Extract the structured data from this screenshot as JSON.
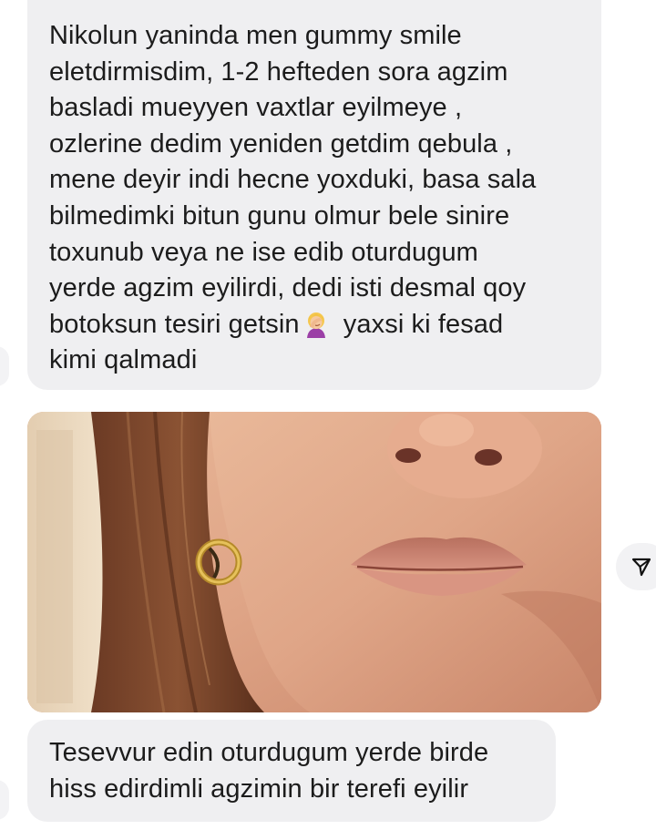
{
  "messages": [
    {
      "text_before_emoji": "Nikolun yaninda men gummy smile\neletdirmisdim, 1-2 hefteden sora agzim\nbasladi mueyyen vaxtlar eyilmeye ,\nozlerine dedim yeniden getdim qebula ,\nmene deyir indi hecne yoxduki, basa sala\nbilmedimki bitun gunu olmur bele sinire\ntoxunub veya ne ise edib oturdugum\nyerde agzim eyilirdi, dedi isti desmal qoy\nbotoksun tesiri getsin",
      "emoji": "woman-facepalming-emoji",
      "text_after_emoji": " yaxsi ki fesad\nkimi qalmadi"
    },
    {
      "image": "photo of lower face with lips and gold earring"
    },
    {
      "text": "Tesevvur edin oturdugum yerde birde\nhiss edirdimli agzimin bir terefi eyilir"
    }
  ],
  "actions": {
    "share_icon": "send-icon"
  },
  "colors": {
    "bubble_bg": "#efeff1",
    "text": "#1c1c1c",
    "background": "#ffffff"
  }
}
